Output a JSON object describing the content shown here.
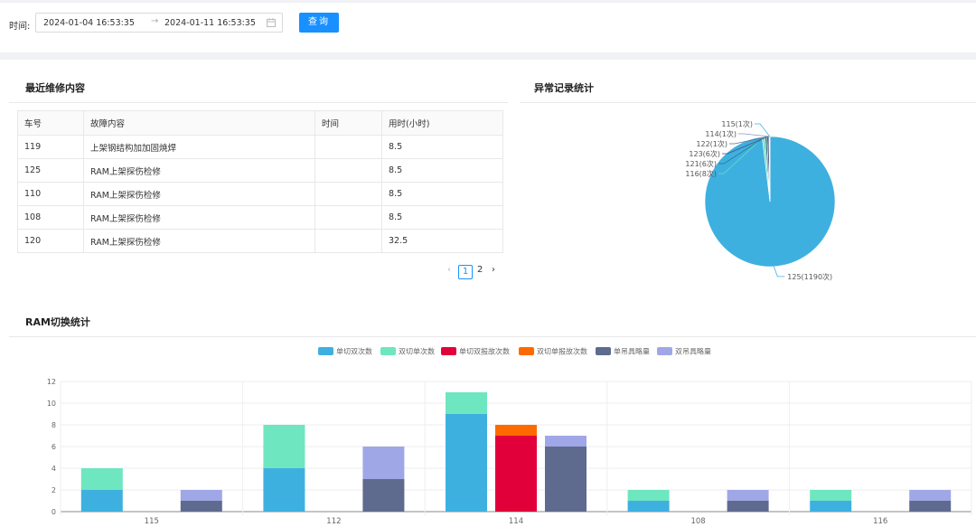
{
  "filter": {
    "time_label": "时间:",
    "start": "2024-01-04 16:53:35",
    "separator": "→",
    "end": "2024-01-11 16:53:35",
    "query_label": "查询"
  },
  "recent": {
    "title": "最近维修内容",
    "columns": [
      "车号",
      "故障内容",
      "时间",
      "用时(小时)"
    ],
    "rows": [
      [
        "119",
        "上架钢结构加加固焼焊",
        "",
        "8.5"
      ],
      [
        "125",
        "RAM上架探伤检修",
        "",
        "8.5"
      ],
      [
        "110",
        "RAM上架探伤检修",
        "",
        "8.5"
      ],
      [
        "108",
        "RAM上架探伤检修",
        "",
        "8.5"
      ],
      [
        "120",
        "RAM上架探伤检修",
        "",
        "32.5"
      ]
    ],
    "pagination": {
      "prev": "‹",
      "pages": [
        "1",
        "2"
      ],
      "current": "1",
      "next": "›"
    }
  },
  "abnormal": {
    "title": "异常记录统计",
    "slices": [
      {
        "label": "125(1190次)",
        "value": 1190,
        "color": "#3eb0e0"
      },
      {
        "label": "116(8次)",
        "value": 8,
        "color": "#6ee0c0"
      },
      {
        "label": "121(6次)",
        "value": 6,
        "color": "#2e6e7e"
      },
      {
        "label": "123(6次)",
        "value": 6,
        "color": "#4a4a7a"
      },
      {
        "label": "122(1次)",
        "value": 1,
        "color": "#5c6b8c"
      },
      {
        "label": "114(1次)",
        "value": 1,
        "color": "#8a94c8"
      },
      {
        "label": "115(1次)",
        "value": 1,
        "color": "#3eb0e0"
      }
    ]
  },
  "ram": {
    "title": "RAM切换统计"
  },
  "chart_data": [
    {
      "type": "pie",
      "title": "异常记录统计",
      "categories": [
        "125",
        "116",
        "121",
        "123",
        "122",
        "114",
        "115"
      ],
      "values": [
        1190,
        8,
        6,
        6,
        1,
        1,
        1
      ]
    },
    {
      "type": "bar",
      "title": "RAM切换统计",
      "categories": [
        "115",
        "112",
        "114",
        "108",
        "116"
      ],
      "ylim": [
        0,
        12
      ],
      "yticks": [
        0,
        2,
        4,
        6,
        8,
        10,
        12
      ],
      "grid": true,
      "legend_position": "top",
      "series": [
        {
          "name": "单切双次数",
          "stack": "a",
          "color": "#3eb0e0",
          "values": [
            2,
            4,
            9,
            1,
            1
          ]
        },
        {
          "name": "双切单次数",
          "stack": "a",
          "color": "#6ee6c0",
          "values": [
            2,
            4,
            2,
            1,
            1
          ]
        },
        {
          "name": "单切双报故次数",
          "stack": "b",
          "color": "#e2003a",
          "values": [
            0,
            0,
            7,
            0,
            0
          ]
        },
        {
          "name": "双切单报故次数",
          "stack": "b",
          "color": "#ff6a00",
          "values": [
            0,
            0,
            1,
            0,
            0
          ]
        },
        {
          "name": "单吊具略量",
          "stack": "c",
          "color": "#5f6a8f",
          "values": [
            1,
            3,
            6,
            1,
            1
          ]
        },
        {
          "name": "双吊具略量",
          "stack": "c",
          "color": "#a0a7e6",
          "values": [
            1,
            3,
            1,
            1,
            1
          ]
        }
      ]
    }
  ]
}
